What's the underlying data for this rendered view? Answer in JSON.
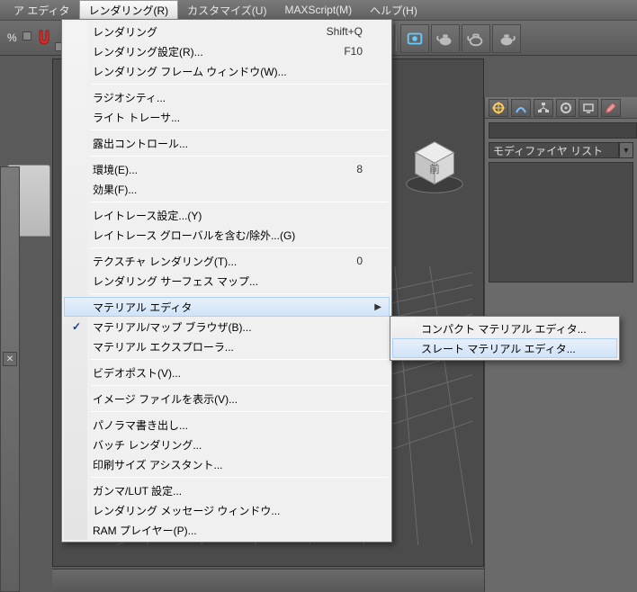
{
  "menubar": {
    "items": [
      {
        "label": "ア エディタ"
      },
      {
        "label": "レンダリング(R)"
      },
      {
        "label": "カスタマイズ(U)"
      },
      {
        "label": "MAXScript(M)"
      },
      {
        "label": "ヘルプ(H)"
      }
    ]
  },
  "toolbar": {
    "percent_label": "%"
  },
  "rendering_menu": {
    "items": [
      {
        "label": "レンダリング",
        "accel": "Shift+Q"
      },
      {
        "label": "レンダリング設定(R)...",
        "accel": "F10"
      },
      {
        "label": "レンダリング フレーム ウィンドウ(W)..."
      },
      {
        "sep": true
      },
      {
        "label": "ラジオシティ..."
      },
      {
        "label": "ライト トレーサ..."
      },
      {
        "sep": true
      },
      {
        "label": "露出コントロール..."
      },
      {
        "sep": true
      },
      {
        "label": "環境(E)...",
        "accel": "8"
      },
      {
        "label": "効果(F)..."
      },
      {
        "sep": true
      },
      {
        "label": "レイトレース設定...(Y)"
      },
      {
        "label": "レイトレース グローバルを含む/除外...(G)"
      },
      {
        "sep": true
      },
      {
        "label": "テクスチャ レンダリング(T)...",
        "accel": "0"
      },
      {
        "label": "レンダリング サーフェス マップ..."
      },
      {
        "sep": true
      },
      {
        "label": "マテリアル エディタ",
        "submenu": true,
        "highlight": true
      },
      {
        "label": "マテリアル/マップ ブラウザ(B)...",
        "checked": true
      },
      {
        "label": "マテリアル エクスプローラ..."
      },
      {
        "sep": true
      },
      {
        "label": "ビデオポスト(V)..."
      },
      {
        "sep": true
      },
      {
        "label": "イメージ ファイルを表示(V)..."
      },
      {
        "sep": true
      },
      {
        "label": "パノラマ書き出し..."
      },
      {
        "label": "バッチ レンダリング..."
      },
      {
        "label": "印刷サイズ アシスタント..."
      },
      {
        "sep": true
      },
      {
        "label": "ガンマ/LUT 設定..."
      },
      {
        "label": "レンダリング メッセージ ウィンドウ..."
      },
      {
        "label": "RAM プレイヤー(P)..."
      }
    ]
  },
  "material_submenu": {
    "items": [
      {
        "label": "コンパクト マテリアル エディタ..."
      },
      {
        "label": "スレート マテリアル エディタ...",
        "highlight": true
      }
    ]
  },
  "command_panel": {
    "name_value": "",
    "modifier_list_label": "モディファイヤ リスト"
  },
  "viewcube": {
    "face_label": "前"
  },
  "icons": {
    "create": "create-icon",
    "modify": "modify-icon",
    "hierarchy": "hierarchy-icon",
    "motion": "motion-icon",
    "display": "display-icon",
    "utilities": "utilities-icon"
  },
  "colors": {
    "panel_bg": "#6a6a6a",
    "accent": "#aecff7",
    "magnet": "#d42d2d"
  }
}
